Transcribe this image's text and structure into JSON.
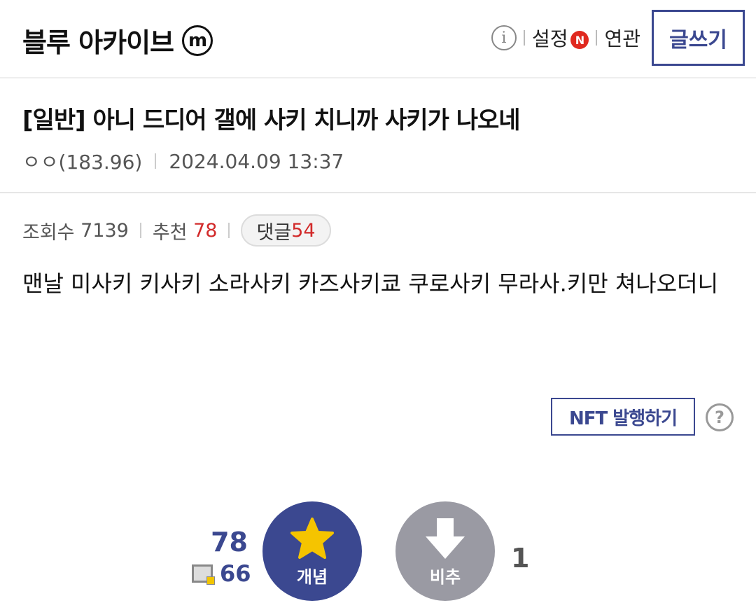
{
  "header": {
    "gallery_name": "블루 아카이브",
    "gallery_badge": "m",
    "settings_label": "설정",
    "settings_badge": "N",
    "related_label": "연관",
    "write_label": "글쓰기"
  },
  "post": {
    "title": "[일반] 아니 드디어 갤에 사키 치니까 사키가 나오네",
    "author": "ㅇㅇ(183.96)",
    "datetime": "2024.04.09 13:37",
    "stats": {
      "views_label": "조회수",
      "views": "7139",
      "recommend_label": "추천",
      "recommend": "78",
      "comments_label": "댓글",
      "comments": "54"
    },
    "body": "맨날 미사키 키사키 소라사키 카즈사키쿄 쿠로사키 무라사.키만 쳐나오더니"
  },
  "nft": {
    "button_label": "NFT 발행하기",
    "help_icon": "?"
  },
  "votes": {
    "up_count": "78",
    "fixed_user_count": "66",
    "up_label": "개념",
    "down_label": "비추",
    "down_count": "1"
  },
  "colors": {
    "accent": "#3b4890",
    "red": "#d22a2a",
    "down_gray": "#9a9aa3",
    "star": "#f5c400"
  }
}
